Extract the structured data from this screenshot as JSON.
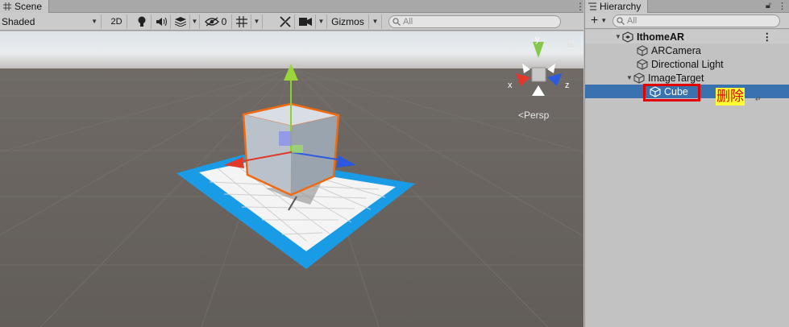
{
  "scene_panel": {
    "tab_label": "Scene",
    "toolbar": {
      "shading_mode": "Shaded",
      "mode_2d_label": "2D",
      "hidden_count": "0",
      "gizmos_label": "Gizmos",
      "search_placeholder": "All"
    },
    "view": {
      "projection_label": "<Persp",
      "axis_x": "x",
      "axis_y": "y",
      "axis_z": "z"
    }
  },
  "hierarchy_panel": {
    "tab_label": "Hierarchy",
    "add_label": "+",
    "search_placeholder": "All",
    "scene_name": "IthomeAR",
    "items": [
      {
        "label": "ARCamera"
      },
      {
        "label": "Directional Light"
      },
      {
        "label": "ImageTarget"
      },
      {
        "label": "Cube"
      }
    ]
  },
  "annotation": {
    "text": "删除"
  },
  "colors": {
    "selection": "#3a72b0",
    "highlight_box": "#e30000",
    "annotation_bg": "#ffff33",
    "annotation_text": "#e00000"
  }
}
